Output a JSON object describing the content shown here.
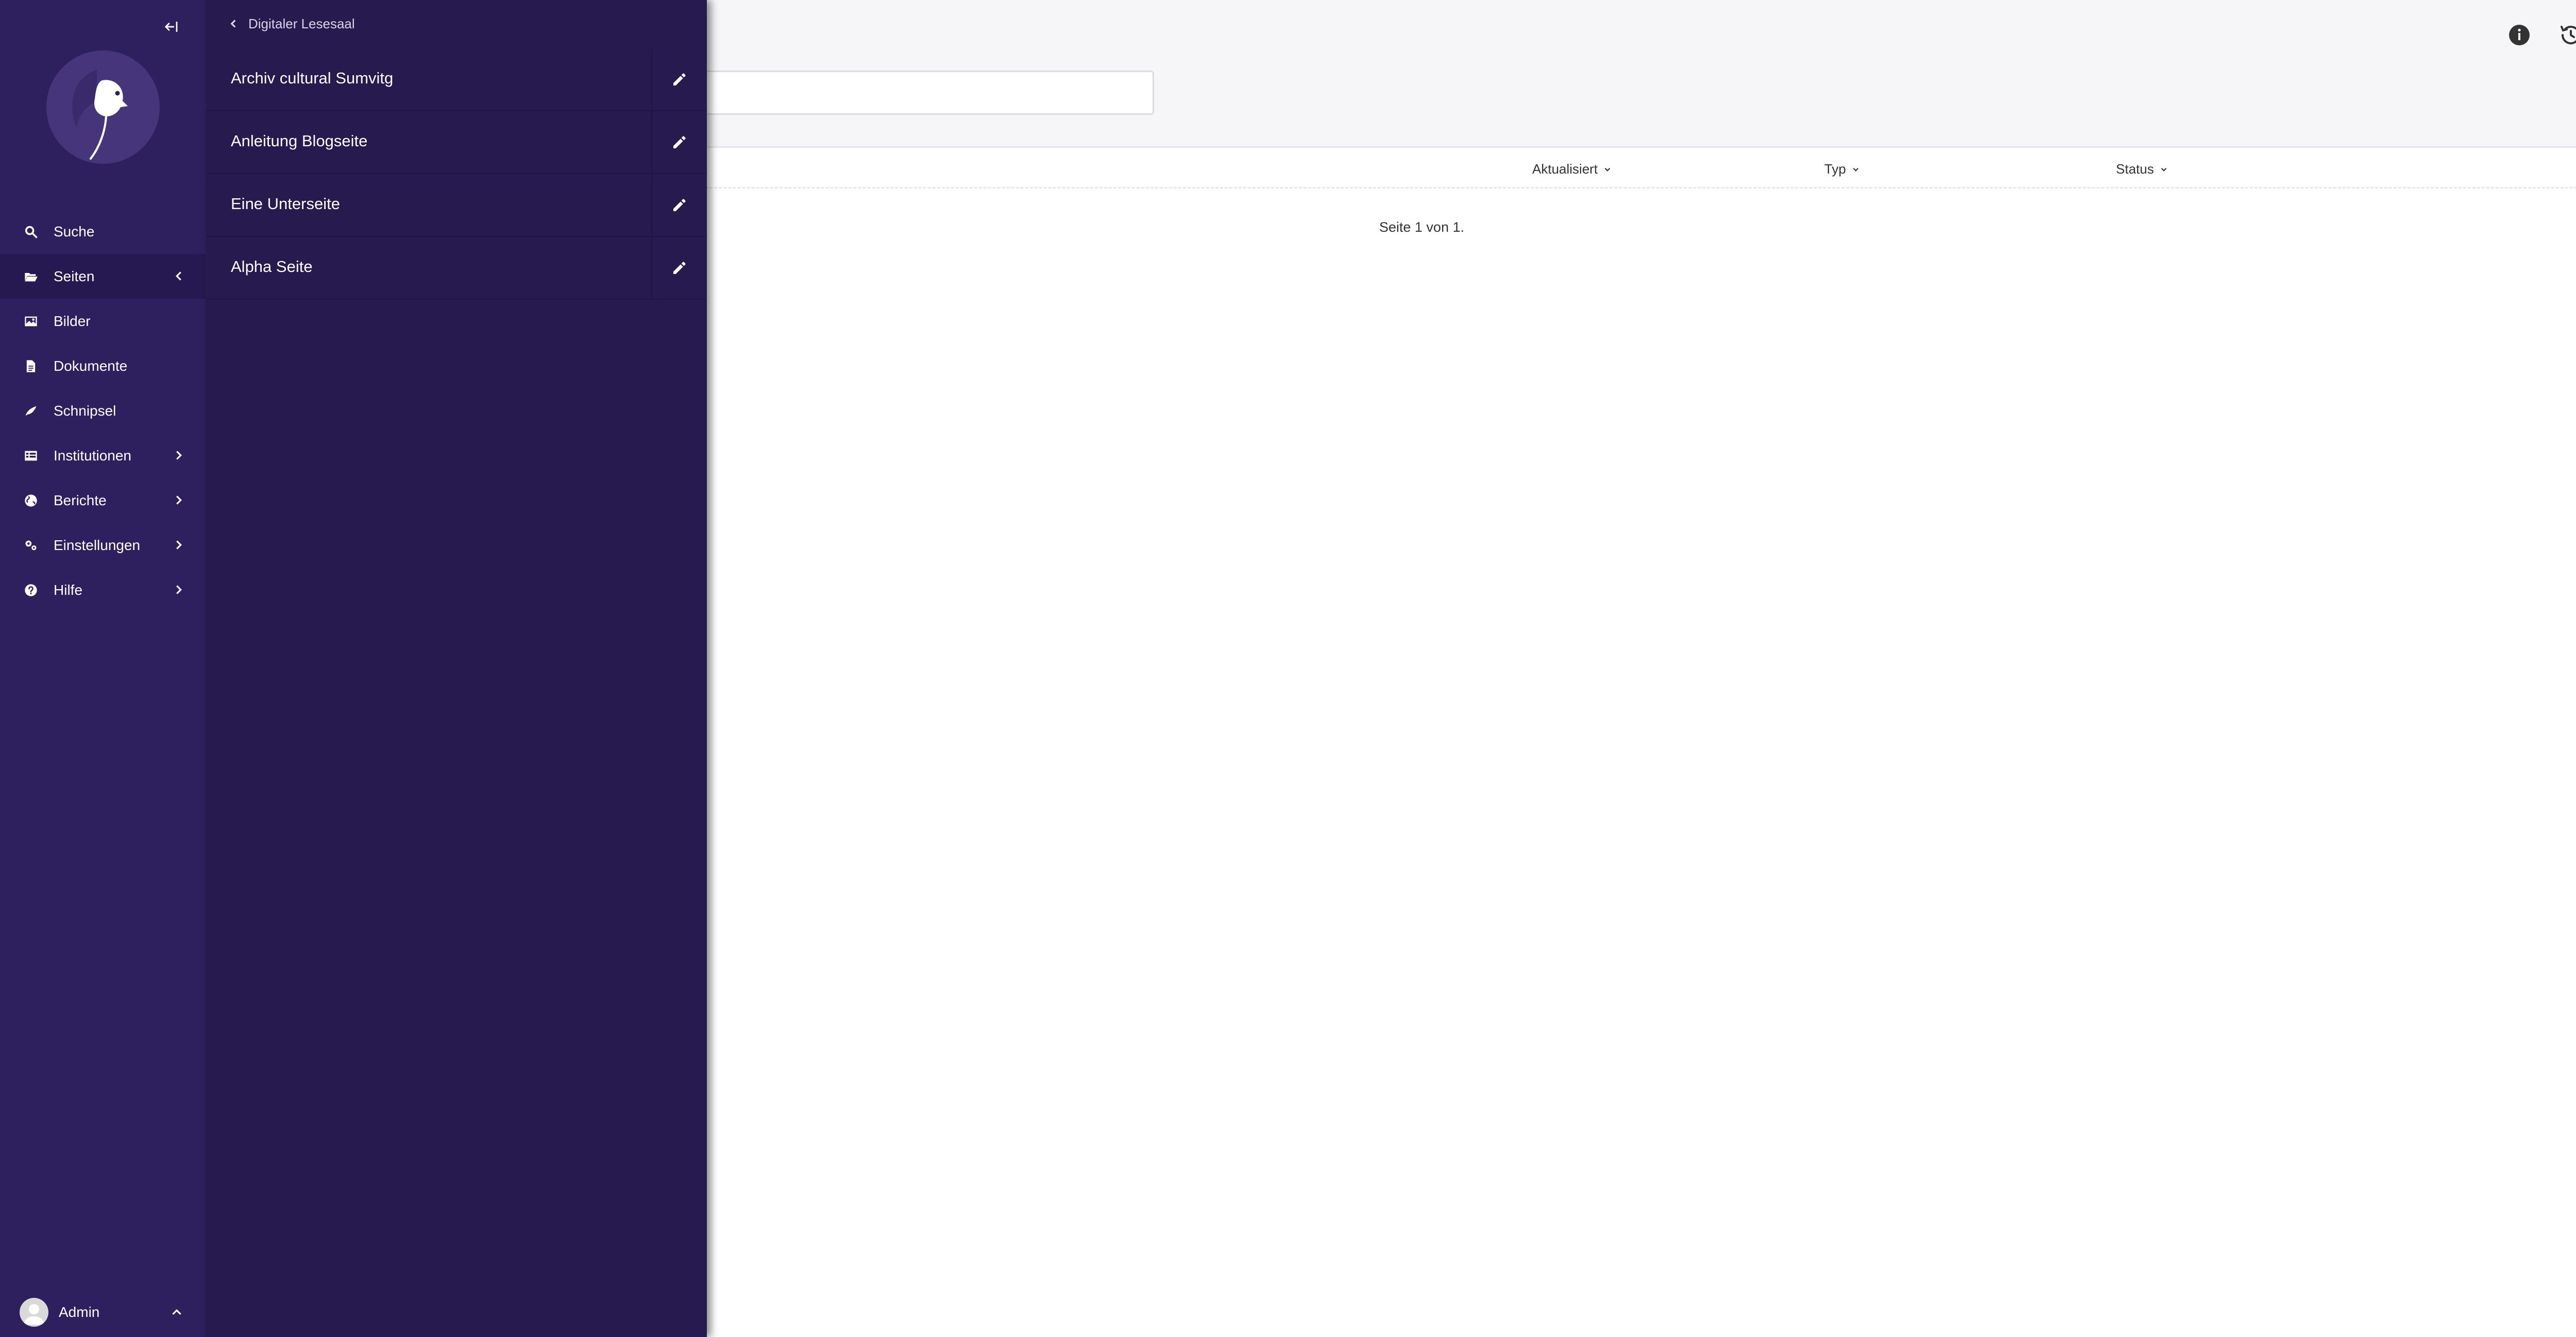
{
  "sidebar": {
    "items": [
      {
        "label": "Suche",
        "icon": "search-icon"
      },
      {
        "label": "Seiten",
        "icon": "folder-open-icon",
        "active": true
      },
      {
        "label": "Bilder",
        "icon": "image-icon"
      },
      {
        "label": "Dokumente",
        "icon": "document-icon"
      },
      {
        "label": "Schnipsel",
        "icon": "snippet-icon"
      },
      {
        "label": "Institutionen",
        "icon": "table-icon"
      },
      {
        "label": "Berichte",
        "icon": "globe-icon"
      },
      {
        "label": "Einstellungen",
        "icon": "cogs-icon"
      },
      {
        "label": "Hilfe",
        "icon": "help-icon"
      }
    ],
    "user": {
      "name": "Admin"
    }
  },
  "explorer": {
    "parent_title": "Digitaler Lesesaal",
    "pages": [
      {
        "title": "Archiv cultural Sumvitg"
      },
      {
        "title": "Anleitung Blogseite"
      },
      {
        "title": "Eine Unterseite"
      },
      {
        "title": "Alpha Seite"
      }
    ]
  },
  "table": {
    "columns": [
      {
        "label": "Aktualisiert"
      },
      {
        "label": "Typ"
      },
      {
        "label": "Status"
      }
    ],
    "pagination": "Seite 1 von 1."
  },
  "colors": {
    "sidebar_bg": "#2e1f5e",
    "explorer_bg": "#271a4f",
    "header_bg": "#f6f6f8"
  }
}
